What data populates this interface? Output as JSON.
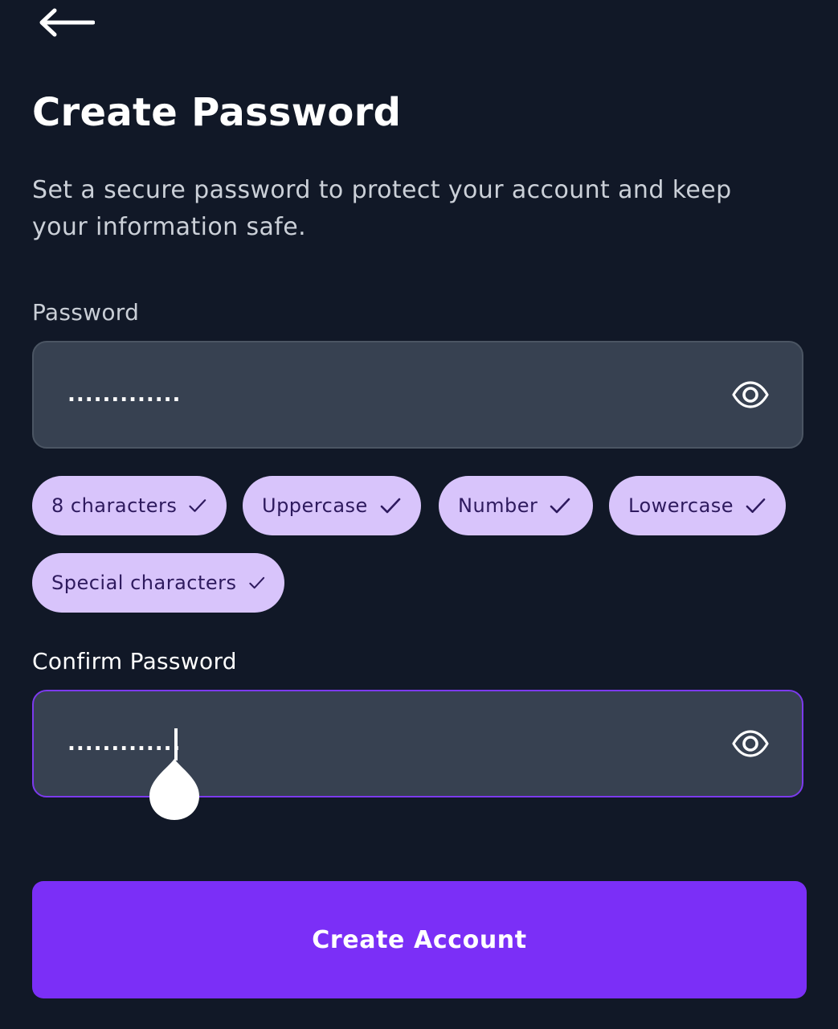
{
  "header": {
    "back_icon": "arrow-left-icon",
    "title": "Create Password",
    "subtitle": "Set a secure password to protect your account and keep your information safe."
  },
  "password": {
    "label": "Password",
    "masked_value": ".............",
    "toggle_icon": "eye-icon"
  },
  "requirements": [
    {
      "label": "8 characters",
      "met": true
    },
    {
      "label": "Uppercase",
      "met": true
    },
    {
      "label": "Number",
      "met": true
    },
    {
      "label": "Lowercase",
      "met": true
    },
    {
      "label": "Special characters",
      "met": true
    }
  ],
  "confirm_password": {
    "label": "Confirm Password",
    "masked_value": ".............",
    "toggle_icon": "eye-icon",
    "focused": true
  },
  "submit": {
    "label": "Create Account"
  },
  "colors": {
    "background": "#111827",
    "input_bg": "#374151",
    "chip_bg": "#d8c4fb",
    "chip_text": "#2e1a5e",
    "accent": "#7b2ff7",
    "focus_border": "#7c3aed"
  }
}
